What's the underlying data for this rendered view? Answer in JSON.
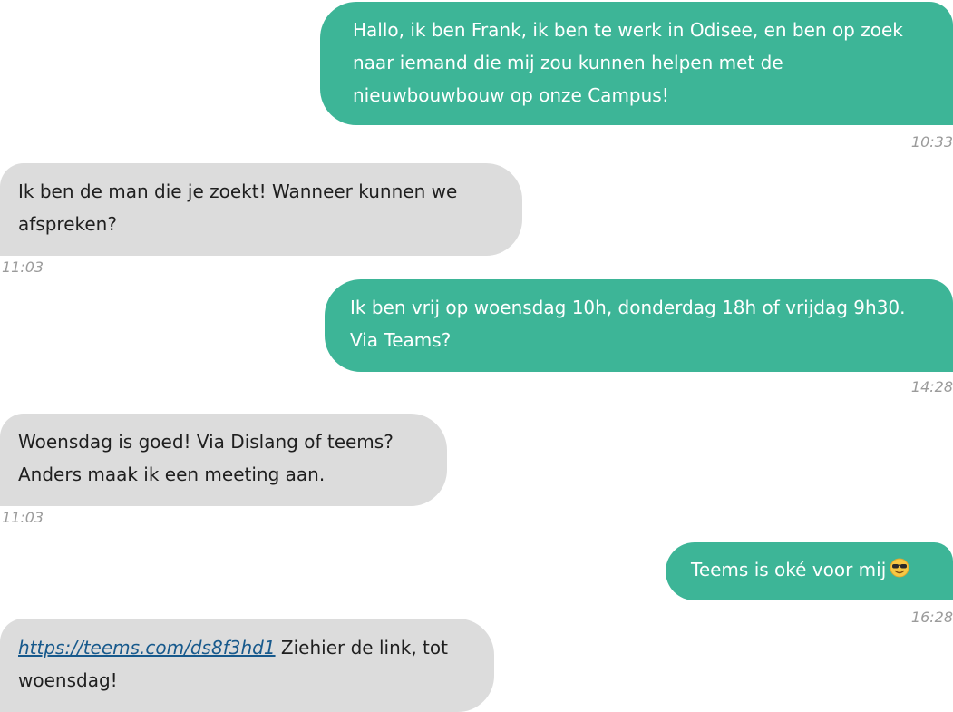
{
  "messages": [
    {
      "side": "sent",
      "lines": [
        "Hallo, ik ben Frank, ik ben te werk in Odisee, en ben op zoek",
        "naar iemand die mij zou kunnen helpen met de",
        "nieuwbouwbouw op onze Campus!"
      ],
      "time": "10:33"
    },
    {
      "side": "received",
      "lines": [
        "Ik ben de man die je zoekt! Wanneer kunnen we",
        "afspreken?"
      ],
      "time": "11:03"
    },
    {
      "side": "sent",
      "lines": [
        "Ik ben vrij op woensdag 10h, donderdag 18h of vrijdag 9h30.",
        "Via Teams?"
      ],
      "time": "14:28"
    },
    {
      "side": "received",
      "lines": [
        "Woensdag is goed! Via Dislang of teems?",
        "Anders maak ik een meeting aan."
      ],
      "time": "11:03"
    },
    {
      "side": "sent",
      "text": "Teems is oké voor mij",
      "emoji": "sunglasses-emoji",
      "time": "16:28"
    },
    {
      "side": "received",
      "link": "https://teems.com/ds8f3hd1",
      "line1_rest": " Ziehier de link, tot",
      "line2": "woensdag!"
    }
  ],
  "colors": {
    "sent_bubble": "#3db597",
    "received_bubble": "#dcdcdc",
    "timestamp": "#9b9b9b",
    "link": "#17598c"
  }
}
